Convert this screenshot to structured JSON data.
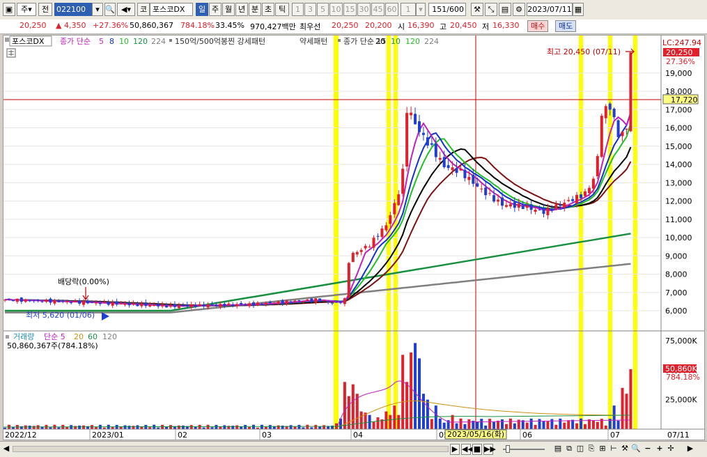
{
  "toolbar": {
    "period_select": "주",
    "prev_btn": "전",
    "code_input": "022100",
    "market_prefix": "코",
    "stock_name": "포스코DX",
    "period_tabs": [
      "일",
      "주",
      "월",
      "년",
      "분",
      "초",
      "틱"
    ],
    "active_period": "일",
    "minute_tabs": [
      "1",
      "3",
      "5",
      "10",
      "15",
      "30",
      "45",
      "60"
    ],
    "interval_value": "1",
    "count_value": "151",
    "count_total": "/600",
    "date_value": "2023/07/11"
  },
  "quote": {
    "price": "20,250",
    "change": "▲ 4,350",
    "change_pct": "+27.36%",
    "volume": "50,860,367",
    "volume_ratio": "784.18%",
    "turnover_pct": "33.45%",
    "trade_value": "970,427백만",
    "best_label": "최우선",
    "ask_price": "20,250",
    "bid_price": "20,200",
    "open_label": "시",
    "open_price": "16,390",
    "high_label": "고",
    "high_price": "20,450",
    "low_label": "저",
    "low_price": "16,330",
    "buy_button": "매수",
    "sell_button": "매도"
  },
  "price_panel": {
    "legend": {
      "name": "포스코DX",
      "ma_label": "종가 단순",
      "ma_periods": [
        "5",
        "8",
        "10",
        "120",
        "224"
      ],
      "pattern_label": "150억/500억봉찐 강세패턴",
      "pattern_weak": "약세패턴",
      "ma2_label": "종가 단순 15",
      "ma2_periods": [
        "20",
        "10",
        "120",
        "224"
      ]
    },
    "lc_label": "LC:247.94",
    "last_price_tag": "20,250",
    "last_pct_tag": "27.36%",
    "crosshair_price_tag": "17,720",
    "high_annotation": "최고 20,450 (07/11)",
    "low_annotation": "최저 5,620 (01/06)",
    "dividend_annotation": "배당락(0.00%)",
    "y_ticks": [
      "19,000",
      "18,000",
      "17,000",
      "16,000",
      "15,000",
      "14,000",
      "13,000",
      "12,000",
      "11,000",
      "10,000",
      "9,000",
      "8,000",
      "7,000",
      "6,000"
    ]
  },
  "volume_panel": {
    "legend_label": "거래량",
    "legend_ma": "단순 5",
    "legend_periods": [
      "20",
      "60",
      "120"
    ],
    "current_volume_text": "50,860,367주(784.18%)",
    "last_volume_tag": "50,860K",
    "last_pct_tag": "784.18%",
    "y_ticks": [
      "75,000K",
      "50,000K",
      "25,000K"
    ]
  },
  "x_axis": {
    "labels": [
      "2022/12",
      "2023/01",
      "02",
      "03",
      "04",
      "05",
      "06",
      "07",
      "07/11"
    ],
    "crosshair_date": "2023/05/16(화)"
  },
  "colors": {
    "up": "#e0202a",
    "down": "#1f3fd0",
    "highlight": "#ffff00",
    "ma5": "#c020c0",
    "ma8": "#1030d0",
    "ma10": "#20c020",
    "ma15": "#000000",
    "ma20": "#801010",
    "ma120": "#189040",
    "ma224": "#808080"
  }
}
